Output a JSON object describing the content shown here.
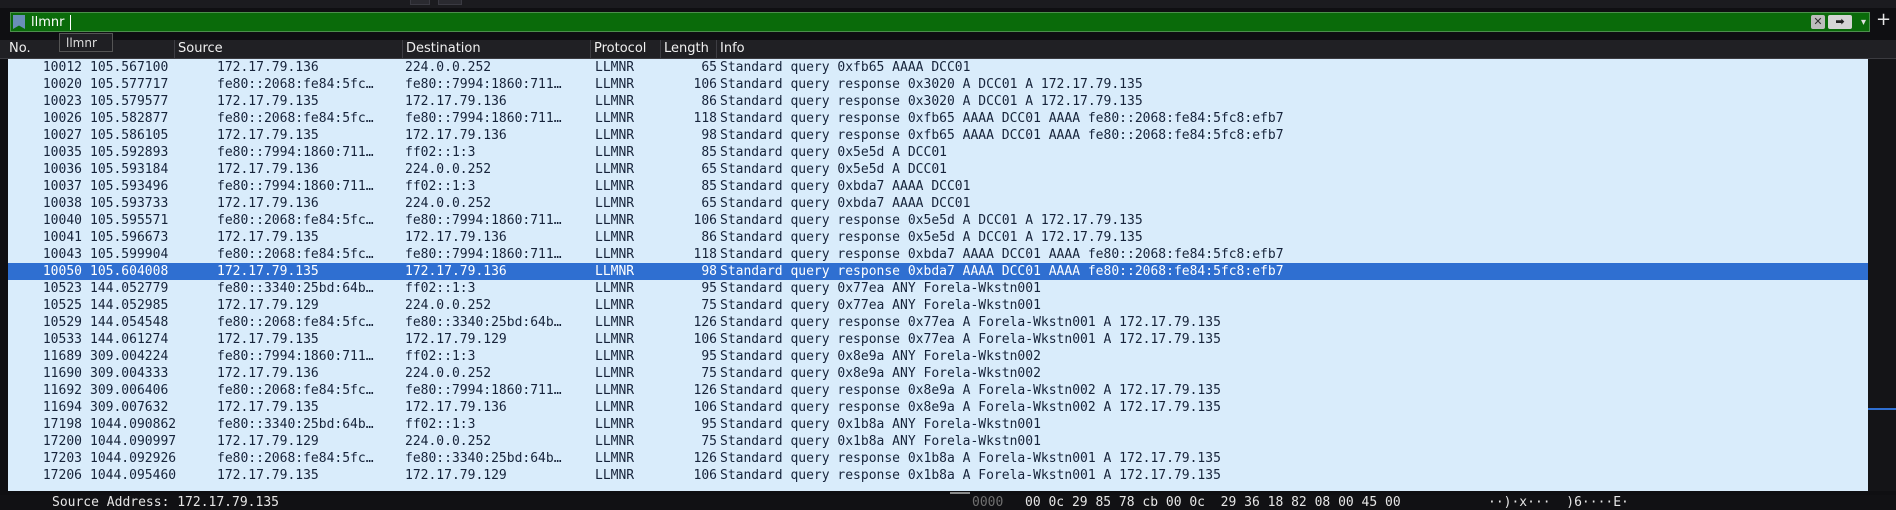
{
  "filter": {
    "value": "llmnr",
    "clear_icon": "clear-icon",
    "apply_icon": "apply-arrow-icon",
    "dropdown_icon": "chevron-down-icon",
    "add_icon": "+",
    "autocomplete": "llmnr",
    "bar_color": "#0a6b0a"
  },
  "columns": {
    "no": "No.",
    "time": "e",
    "source": "Source",
    "destination": "Destination",
    "protocol": "Protocol",
    "length": "Length",
    "info": "Info"
  },
  "packets": [
    {
      "no": "10012",
      "time": "105.567100",
      "source": "172.17.79.136",
      "destination": "224.0.0.252",
      "protocol": "LLMNR",
      "length": "65",
      "info": "Standard query 0xfb65 AAAA DCC01"
    },
    {
      "no": "10020",
      "time": "105.577717",
      "source": "fe80::2068:fe84:5fc…",
      "destination": "fe80::7994:1860:711…",
      "protocol": "LLMNR",
      "length": "106",
      "info": "Standard query response 0x3020 A DCC01 A 172.17.79.135"
    },
    {
      "no": "10023",
      "time": "105.579577",
      "source": "172.17.79.135",
      "destination": "172.17.79.136",
      "protocol": "LLMNR",
      "length": "86",
      "info": "Standard query response 0x3020 A DCC01 A 172.17.79.135"
    },
    {
      "no": "10026",
      "time": "105.582877",
      "source": "fe80::2068:fe84:5fc…",
      "destination": "fe80::7994:1860:711…",
      "protocol": "LLMNR",
      "length": "118",
      "info": "Standard query response 0xfb65 AAAA DCC01 AAAA fe80::2068:fe84:5fc8:efb7"
    },
    {
      "no": "10027",
      "time": "105.586105",
      "source": "172.17.79.135",
      "destination": "172.17.79.136",
      "protocol": "LLMNR",
      "length": "98",
      "info": "Standard query response 0xfb65 AAAA DCC01 AAAA fe80::2068:fe84:5fc8:efb7"
    },
    {
      "no": "10035",
      "time": "105.592893",
      "source": "fe80::7994:1860:711…",
      "destination": "ff02::1:3",
      "protocol": "LLMNR",
      "length": "85",
      "info": "Standard query 0x5e5d A DCC01"
    },
    {
      "no": "10036",
      "time": "105.593184",
      "source": "172.17.79.136",
      "destination": "224.0.0.252",
      "protocol": "LLMNR",
      "length": "65",
      "info": "Standard query 0x5e5d A DCC01"
    },
    {
      "no": "10037",
      "time": "105.593496",
      "source": "fe80::7994:1860:711…",
      "destination": "ff02::1:3",
      "protocol": "LLMNR",
      "length": "85",
      "info": "Standard query 0xbda7 AAAA DCC01"
    },
    {
      "no": "10038",
      "time": "105.593733",
      "source": "172.17.79.136",
      "destination": "224.0.0.252",
      "protocol": "LLMNR",
      "length": "65",
      "info": "Standard query 0xbda7 AAAA DCC01"
    },
    {
      "no": "10040",
      "time": "105.595571",
      "source": "fe80::2068:fe84:5fc…",
      "destination": "fe80::7994:1860:711…",
      "protocol": "LLMNR",
      "length": "106",
      "info": "Standard query response 0x5e5d A DCC01 A 172.17.79.135"
    },
    {
      "no": "10041",
      "time": "105.596673",
      "source": "172.17.79.135",
      "destination": "172.17.79.136",
      "protocol": "LLMNR",
      "length": "86",
      "info": "Standard query response 0x5e5d A DCC01 A 172.17.79.135"
    },
    {
      "no": "10043",
      "time": "105.599904",
      "source": "fe80::2068:fe84:5fc…",
      "destination": "fe80::7994:1860:711…",
      "protocol": "LLMNR",
      "length": "118",
      "info": "Standard query response 0xbda7 AAAA DCC01 AAAA fe80::2068:fe84:5fc8:efb7"
    },
    {
      "no": "10050",
      "time": "105.604008",
      "source": "172.17.79.135",
      "destination": "172.17.79.136",
      "protocol": "LLMNR",
      "length": "98",
      "info": "Standard query response 0xbda7 AAAA DCC01 AAAA fe80::2068:fe84:5fc8:efb7",
      "selected": true
    },
    {
      "no": "10523",
      "time": "144.052779",
      "source": "fe80::3340:25bd:64b…",
      "destination": "ff02::1:3",
      "protocol": "LLMNR",
      "length": "95",
      "info": "Standard query 0x77ea ANY Forela-Wkstn001"
    },
    {
      "no": "10525",
      "time": "144.052985",
      "source": "172.17.79.129",
      "destination": "224.0.0.252",
      "protocol": "LLMNR",
      "length": "75",
      "info": "Standard query 0x77ea ANY Forela-Wkstn001"
    },
    {
      "no": "10529",
      "time": "144.054548",
      "source": "fe80::2068:fe84:5fc…",
      "destination": "fe80::3340:25bd:64b…",
      "protocol": "LLMNR",
      "length": "126",
      "info": "Standard query response 0x77ea A Forela-Wkstn001 A 172.17.79.135"
    },
    {
      "no": "10533",
      "time": "144.061274",
      "source": "172.17.79.135",
      "destination": "172.17.79.129",
      "protocol": "LLMNR",
      "length": "106",
      "info": "Standard query response 0x77ea A Forela-Wkstn001 A 172.17.79.135"
    },
    {
      "no": "11689",
      "time": "309.004224",
      "source": "fe80::7994:1860:711…",
      "destination": "ff02::1:3",
      "protocol": "LLMNR",
      "length": "95",
      "info": "Standard query 0x8e9a ANY Forela-Wkstn002"
    },
    {
      "no": "11690",
      "time": "309.004333",
      "source": "172.17.79.136",
      "destination": "224.0.0.252",
      "protocol": "LLMNR",
      "length": "75",
      "info": "Standard query 0x8e9a ANY Forela-Wkstn002"
    },
    {
      "no": "11692",
      "time": "309.006406",
      "source": "fe80::2068:fe84:5fc…",
      "destination": "fe80::7994:1860:711…",
      "protocol": "LLMNR",
      "length": "126",
      "info": "Standard query response 0x8e9a A Forela-Wkstn002 A 172.17.79.135"
    },
    {
      "no": "11694",
      "time": "309.007632",
      "source": "172.17.79.135",
      "destination": "172.17.79.136",
      "protocol": "LLMNR",
      "length": "106",
      "info": "Standard query response 0x8e9a A Forela-Wkstn002 A 172.17.79.135"
    },
    {
      "no": "17198",
      "time": "1044.090862",
      "source": "fe80::3340:25bd:64b…",
      "destination": "ff02::1:3",
      "protocol": "LLMNR",
      "length": "95",
      "info": "Standard query 0x1b8a ANY Forela-Wkstn001"
    },
    {
      "no": "17200",
      "time": "1044.090997",
      "source": "172.17.79.129",
      "destination": "224.0.0.252",
      "protocol": "LLMNR",
      "length": "75",
      "info": "Standard query 0x1b8a ANY Forela-Wkstn001"
    },
    {
      "no": "17203",
      "time": "1044.092926",
      "source": "fe80::2068:fe84:5fc…",
      "destination": "fe80::3340:25bd:64b…",
      "protocol": "LLMNR",
      "length": "126",
      "info": "Standard query response 0x1b8a A Forela-Wkstn001 A 172.17.79.135"
    },
    {
      "no": "17206",
      "time": "1044.095460",
      "source": "172.17.79.135",
      "destination": "172.17.79.129",
      "protocol": "LLMNR",
      "length": "106",
      "info": "Standard query response 0x1b8a A Forela-Wkstn001 A 172.17.79.135"
    }
  ],
  "details": {
    "text": "Source Address: 172.17.79.135"
  },
  "hex": {
    "offset": "0000",
    "bytes": "00 0c 29 85 78 cb 00 0c  29 36 18 82 08 00 45 00",
    "ascii": "··)·x···  )6····E·"
  },
  "colors": {
    "row_background": "#d9ecfb",
    "selected_row": "#2f6fd1",
    "filter_valid": "#0a6b0a"
  }
}
